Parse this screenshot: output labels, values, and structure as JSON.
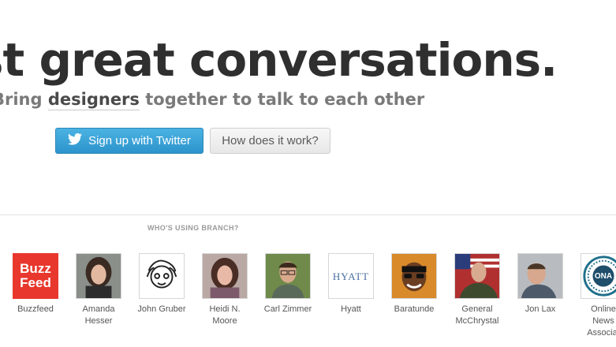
{
  "hero": {
    "title": "st great conversations.",
    "subtitle_pre": "Bring ",
    "subtitle_keyword": "designers",
    "subtitle_post": " together to talk to each other"
  },
  "buttons": {
    "twitter_label": "Sign up with Twitter",
    "how_label": "How does it work?"
  },
  "users": {
    "heading": "WHO'S USING BRANCH?",
    "items": [
      {
        "name_line1": "Buzzfeed",
        "name_line2": "",
        "avatar_text1": "Buzz",
        "avatar_text2": "Feed"
      },
      {
        "name_line1": "Amanda",
        "name_line2": "Hesser"
      },
      {
        "name_line1": "John Gruber",
        "name_line2": ""
      },
      {
        "name_line1": "Heidi N.",
        "name_line2": "Moore"
      },
      {
        "name_line1": "Carl Zimmer",
        "name_line2": ""
      },
      {
        "name_line1": "Hyatt",
        "name_line2": "",
        "avatar_text1": "HYATT"
      },
      {
        "name_line1": "Baratunde",
        "name_line2": ""
      },
      {
        "name_line1": "General",
        "name_line2": "McChrystal"
      },
      {
        "name_line1": "Jon Lax",
        "name_line2": ""
      },
      {
        "name_line1": "Online",
        "name_line2": "News",
        "name_line3": "Associat",
        "avatar_text1": "ONA"
      }
    ]
  }
}
